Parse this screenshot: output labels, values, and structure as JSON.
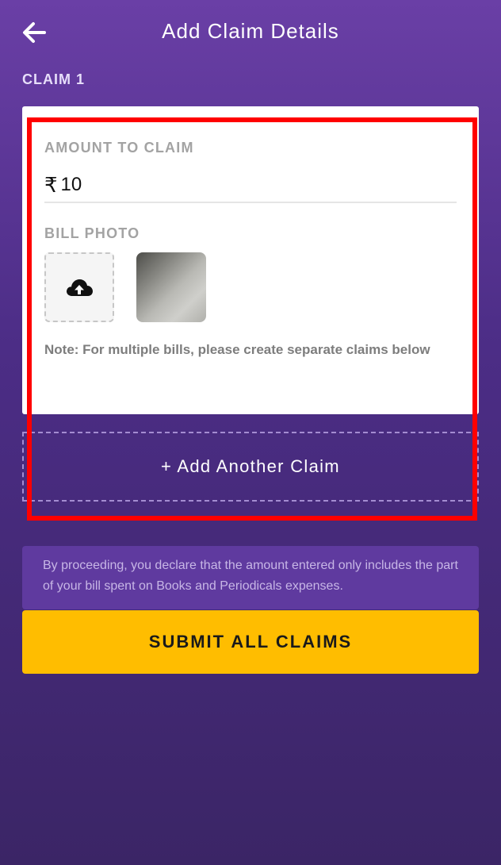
{
  "header": {
    "title": "Add Claim Details",
    "back_icon": "arrow-left-icon"
  },
  "claim": {
    "label": "CLAIM 1",
    "amount_label": "AMOUNT TO CLAIM",
    "currency_symbol": "₹",
    "amount_value": "10",
    "bill_photo_label": "BILL PHOTO",
    "upload_icon": "cloud-upload-icon",
    "note": "Note: For multiple bills, please create separate claims below"
  },
  "actions": {
    "add_another_claim": "+ Add Another Claim",
    "submit_all": "SUBMIT ALL CLAIMS"
  },
  "disclaimer": "By proceeding, you declare that the amount entered only includes the part of your bill spent on Books and Periodicals expenses.",
  "colors": {
    "background_top": "#6a3fa6",
    "background_bottom": "#3b2566",
    "submit_button": "#ffbd00",
    "highlight_border": "#ff0000"
  }
}
